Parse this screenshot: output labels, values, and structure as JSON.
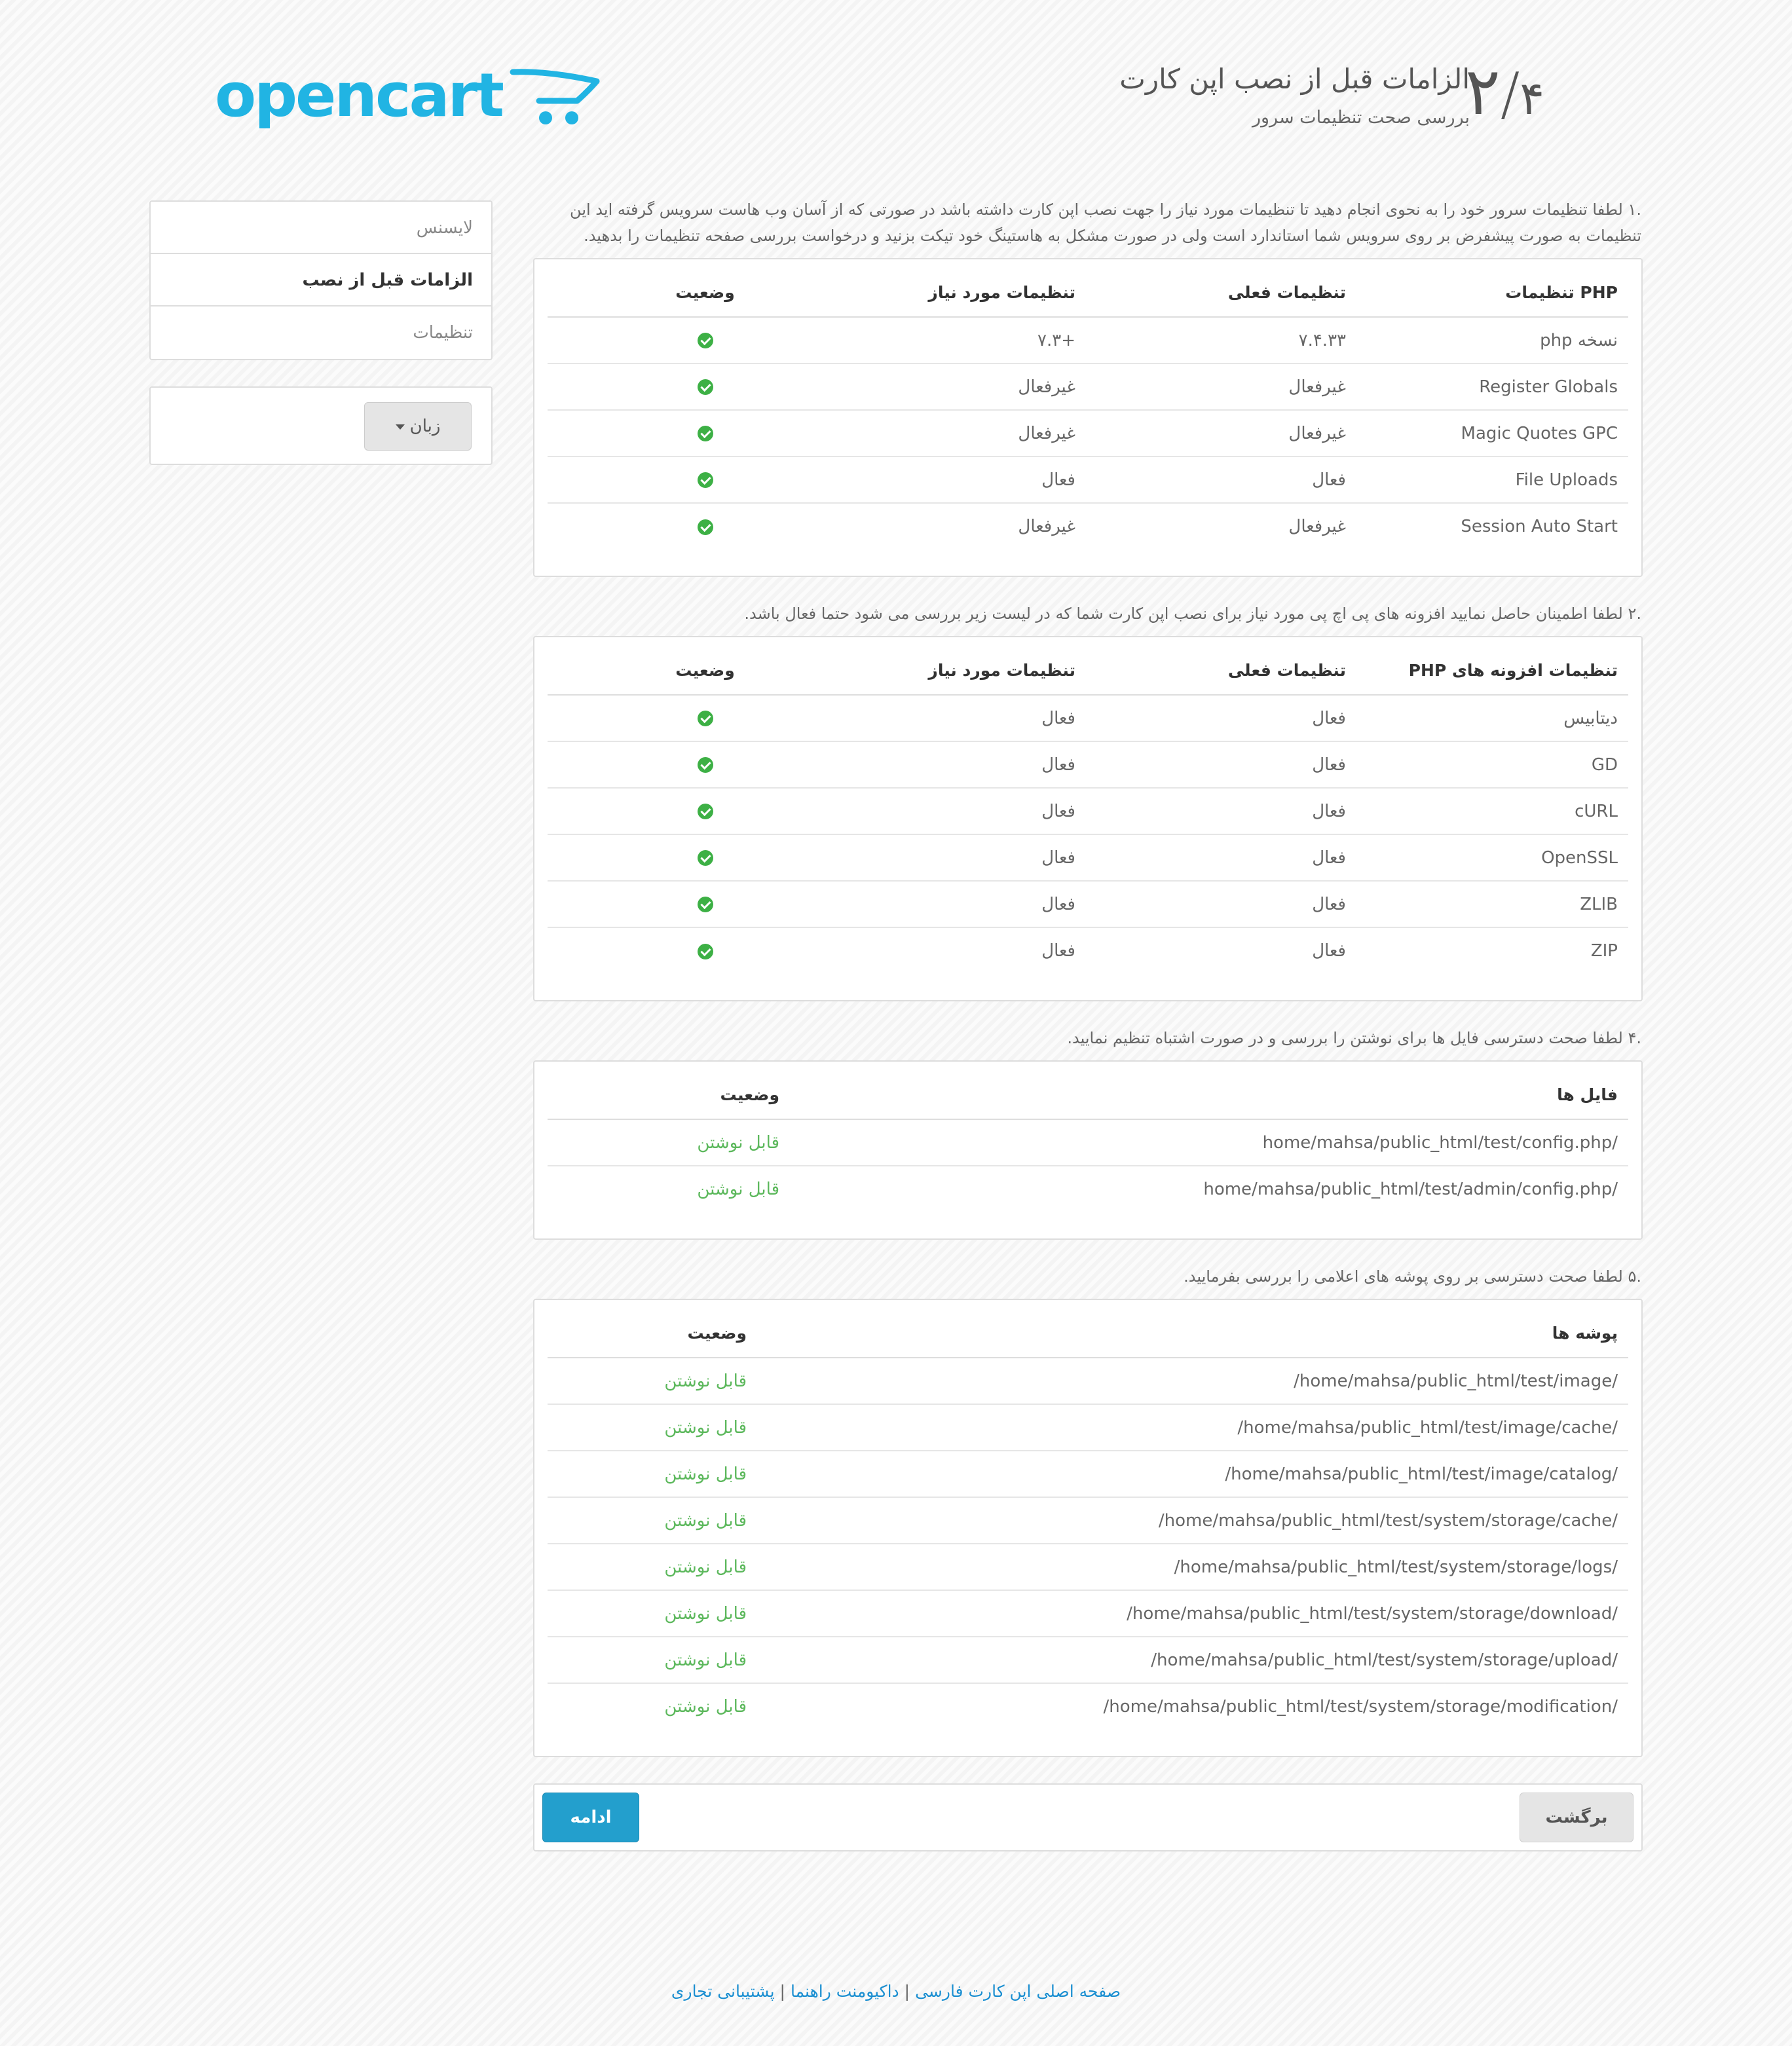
{
  "header": {
    "step_current": "۲",
    "step_total": "۴",
    "title": "الزامات قبل از نصب اپن کارت",
    "subtitle": "بررسی صحت تنظیمات سرور",
    "logo_text": "opencart",
    "brand_color": "#21b4e3"
  },
  "sidebar": {
    "items": [
      {
        "label": "لایسنس"
      },
      {
        "label": "الزامات قبل از نصب"
      },
      {
        "label": "تنظیمات"
      }
    ],
    "language_button": "زبان"
  },
  "section1": {
    "intro": ".۱ لطفا تنظیمات سرور خود را به نحوی انجام دهید تا تنظیمات مورد نیاز را جهت نصب اپن کارت داشته باشد در صورتی که از آسان وب هاست سرویس گرفته اید این تنظیمات به صورت پیشفرض بر روی سرویس شما استاندارد است ولی در صورت مشکل به هاستینگ خود تیکت بزنید و درخواست بررسی صفحه تنظیمات را بدهید.",
    "headers": [
      "PHP تنظیمات",
      "تنظیمات فعلی",
      "تنظیمات مورد نیاز",
      "وضعیت"
    ],
    "rows": [
      {
        "name": "نسخه php",
        "current": "۷.۴.۳۳",
        "required": "+۷.۳"
      },
      {
        "name": "Register Globals",
        "current": "غیرفعال",
        "required": "غیرفعال"
      },
      {
        "name": "Magic Quotes GPC",
        "current": "غیرفعال",
        "required": "غیرفعال"
      },
      {
        "name": "File Uploads",
        "current": "فعال",
        "required": "فعال"
      },
      {
        "name": "Session Auto Start",
        "current": "غیرفعال",
        "required": "غیرفعال"
      }
    ]
  },
  "section2": {
    "intro": ".۲ لطفا اطمینان حاصل نمایید افزونه های پی اچ پی مورد نیاز برای نصب اپن کارت شما که در لیست زیر بررسی می شود حتما فعال باشد.",
    "headers": [
      "تنظیمات افزونه های PHP",
      "تنظیمات فعلی",
      "تنظیمات مورد نیاز",
      "وضعیت"
    ],
    "rows": [
      {
        "name": "دیتابیس",
        "current": "فعال",
        "required": "فعال"
      },
      {
        "name": "GD",
        "current": "فعال",
        "required": "فعال"
      },
      {
        "name": "cURL",
        "current": "فعال",
        "required": "فعال"
      },
      {
        "name": "OpenSSL",
        "current": "فعال",
        "required": "فعال"
      },
      {
        "name": "ZLIB",
        "current": "فعال",
        "required": "فعال"
      },
      {
        "name": "ZIP",
        "current": "فعال",
        "required": "فعال"
      }
    ]
  },
  "section4": {
    "intro": ".۴ لطفا صحت دسترسی فایل ها برای نوشتن را بررسی و در صورت اشتباه تنظیم نمایید.",
    "headers": [
      "فایل ها",
      "وضعیت"
    ],
    "rows": [
      {
        "path": "home/mahsa/public_html/test/config.php/",
        "status": "قابل نوشتن"
      },
      {
        "path": "home/mahsa/public_html/test/admin/config.php/",
        "status": "قابل نوشتن"
      }
    ]
  },
  "section5": {
    "intro": ".۵ لطفا صحت دسترسی بر روی پوشه های اعلامی را بررسی بفرمایید.",
    "headers": [
      "پوشه ها",
      "وضعیت"
    ],
    "rows": [
      {
        "path": "/home/mahsa/public_html/test/image/",
        "status": "قابل نوشتن"
      },
      {
        "path": "/home/mahsa/public_html/test/image/cache/",
        "status": "قابل نوشتن"
      },
      {
        "path": "/home/mahsa/public_html/test/image/catalog/",
        "status": "قابل نوشتن"
      },
      {
        "path": "/home/mahsa/public_html/test/system/storage/cache/",
        "status": "قابل نوشتن"
      },
      {
        "path": "/home/mahsa/public_html/test/system/storage/logs/",
        "status": "قابل نوشتن"
      },
      {
        "path": "/home/mahsa/public_html/test/system/storage/download/",
        "status": "قابل نوشتن"
      },
      {
        "path": "/home/mahsa/public_html/test/system/storage/upload/",
        "status": "قابل نوشتن"
      },
      {
        "path": "/home/mahsa/public_html/test/system/storage/modification/",
        "status": "قابل نوشتن"
      }
    ]
  },
  "buttons": {
    "back": "برگشت",
    "next": "ادامه"
  },
  "footer": {
    "links": [
      "صفحه اصلی اپن کارت فارسی",
      "داکیومنت راهنما",
      "پشتیبانی تجاری"
    ],
    "separator": "|"
  },
  "colors": {
    "ok": "#3db045",
    "writable": "#5cb85c",
    "primary_button": "#239fcd",
    "link": "#1b8fd1"
  }
}
